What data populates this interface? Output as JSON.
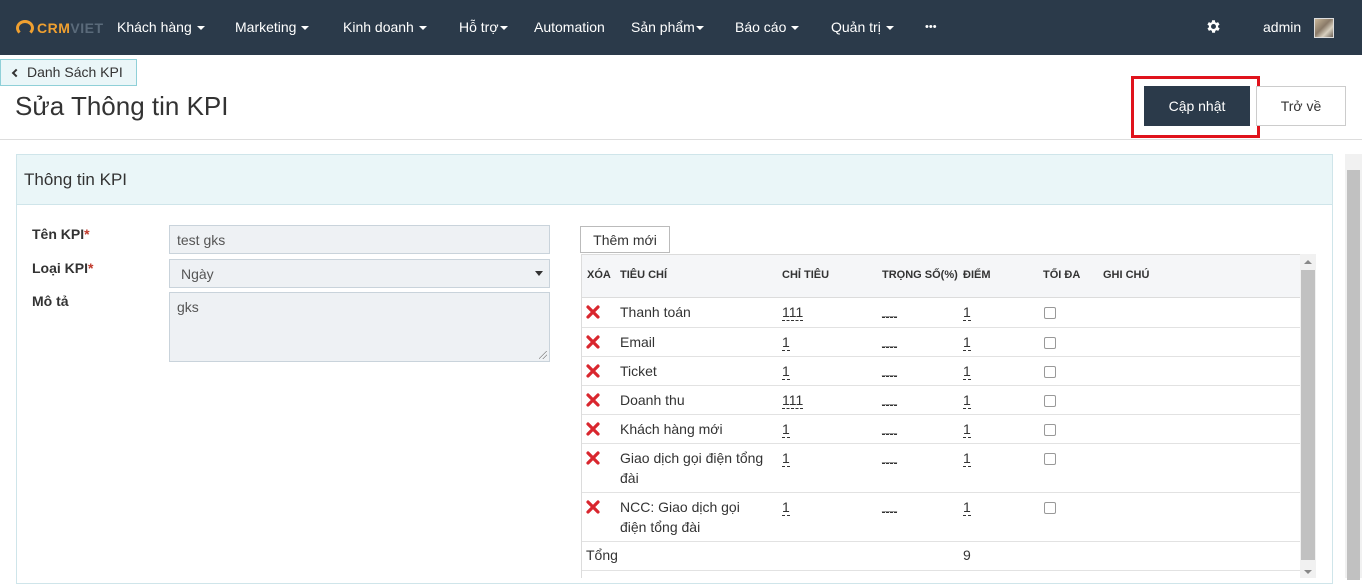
{
  "nav": {
    "logo_crm": "CRM",
    "logo_viet": "VIET",
    "items": [
      {
        "label": "Khách hàng",
        "dropdown": true
      },
      {
        "label": "Marketing",
        "dropdown": true
      },
      {
        "label": "Kinh doanh",
        "dropdown": true
      },
      {
        "label": "Hỗ trợ",
        "dropdown": true
      },
      {
        "label": "Automation",
        "dropdown": false
      },
      {
        "label": "Sản phẩm",
        "dropdown": true
      },
      {
        "label": "Báo cáo",
        "dropdown": true
      },
      {
        "label": "Quản trị",
        "dropdown": true
      },
      {
        "label": "•••",
        "dropdown": false
      }
    ],
    "settings_icon": "gear-icon",
    "user": "admin"
  },
  "header": {
    "back_link": "Danh Sách KPI",
    "title": "Sửa Thông tin KPI",
    "update_button": "Cập nhật",
    "back_button": "Trở về",
    "highlight_color": "#e0131c"
  },
  "panel": {
    "title": "Thông tin KPI"
  },
  "form": {
    "name_label": "Tên KPI",
    "name_value": "test gks",
    "type_label": "Loại KPI",
    "type_value": "Ngày",
    "desc_label": "Mô tả",
    "desc_value": "gks",
    "required_mark": "*"
  },
  "table": {
    "add_button": "Thêm mới",
    "headers": {
      "delete": "XÓA",
      "criteria": "TIÊU CHÍ",
      "target": "CHỈ TIÊU",
      "weight": "TRỌNG SỐ(%)",
      "score": "ĐIỂM",
      "max": "TỐI ĐA",
      "note": "GHI CHÚ"
    },
    "rows": [
      {
        "criteria": [
          "Thanh toán"
        ],
        "target": "111",
        "weight": "___",
        "score": "1",
        "max": false
      },
      {
        "criteria": [
          "Email"
        ],
        "target": "1",
        "weight": "___",
        "score": "1",
        "max": false
      },
      {
        "criteria": [
          "Ticket"
        ],
        "target": "1",
        "weight": "___",
        "score": "1",
        "max": false
      },
      {
        "criteria": [
          "Doanh thu"
        ],
        "target": "111",
        "weight": "___",
        "score": "1",
        "max": false
      },
      {
        "criteria": [
          "Khách hàng mới"
        ],
        "target": "1",
        "weight": "___",
        "score": "1",
        "max": false
      },
      {
        "criteria": [
          "Giao dịch gọi điện tổng",
          "đài"
        ],
        "target": "1",
        "weight": "___",
        "score": "1",
        "max": false
      },
      {
        "criteria": [
          "NCC: Giao dịch gọi",
          "điện tổng đài"
        ],
        "target": "1",
        "weight": "___",
        "score": "1",
        "max": false
      }
    ],
    "total_label": "Tổng",
    "total_score": "9"
  }
}
